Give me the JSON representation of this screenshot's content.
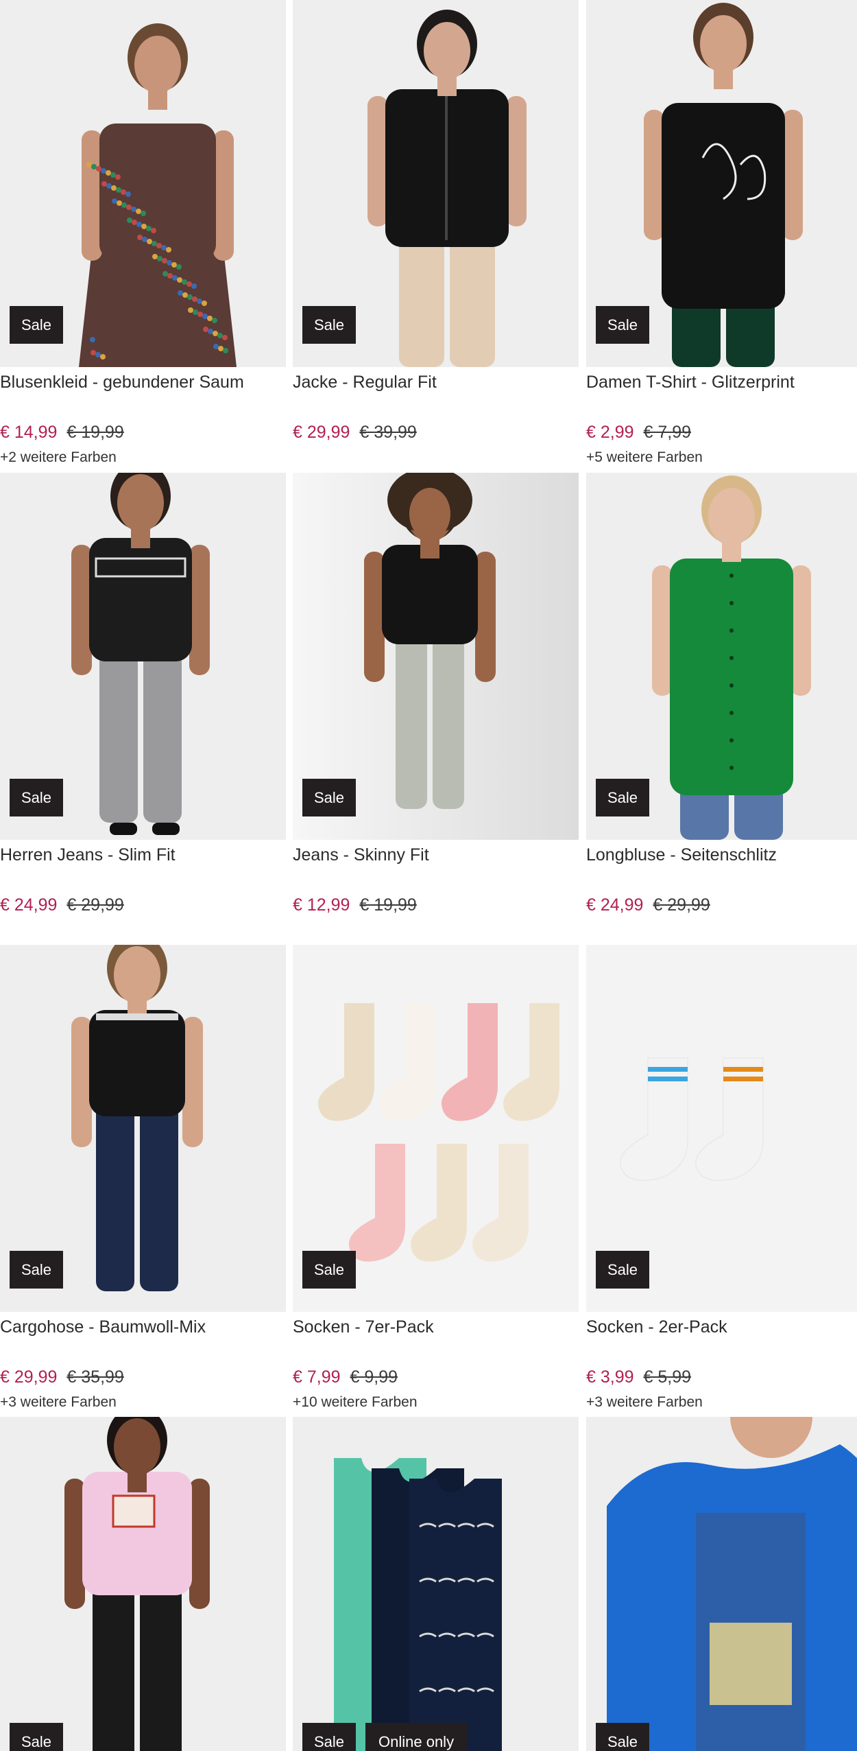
{
  "products": [
    {
      "title": "Blusenkleid - gebundener Saum",
      "price": "€ 14,99",
      "old_price": "€ 19,99",
      "colors": "+2 weitere Farben",
      "badges": [
        "Sale"
      ]
    },
    {
      "title": "Jacke - Regular Fit",
      "price": "€ 29,99",
      "old_price": "€ 39,99",
      "colors": "",
      "badges": [
        "Sale"
      ]
    },
    {
      "title": "Damen T-Shirt - Glitzerprint",
      "price": "€ 2,99",
      "old_price": "€ 7,99",
      "colors": "+5 weitere Farben",
      "badges": [
        "Sale"
      ]
    },
    {
      "title": "Herren Jeans - Slim Fit",
      "price": "€ 24,99",
      "old_price": "€ 29,99",
      "colors": "",
      "badges": [
        "Sale"
      ]
    },
    {
      "title": "Jeans - Skinny Fit",
      "price": "€ 12,99",
      "old_price": "€ 19,99",
      "colors": "",
      "badges": [
        "Sale"
      ]
    },
    {
      "title": "Longbluse - Seitenschlitz",
      "price": "€ 24,99",
      "old_price": "€ 29,99",
      "colors": "",
      "badges": [
        "Sale"
      ]
    },
    {
      "title": "Cargohose - Baumwoll-Mix",
      "price": "€ 29,99",
      "old_price": "€ 35,99",
      "colors": "+3 weitere Farben",
      "badges": [
        "Sale"
      ]
    },
    {
      "title": "Socken - 7er-Pack",
      "price": "€ 7,99",
      "old_price": "€ 9,99",
      "colors": "+10 weitere Farben",
      "badges": [
        "Sale"
      ]
    },
    {
      "title": "Socken - 2er-Pack",
      "price": "€ 3,99",
      "old_price": "€ 5,99",
      "colors": "+3 weitere Farben",
      "badges": [
        "Sale"
      ]
    },
    {
      "title": "",
      "price": "",
      "old_price": "",
      "colors": "",
      "badges": [
        "Sale"
      ]
    },
    {
      "title": "",
      "price": "",
      "old_price": "",
      "colors": "",
      "badges": [
        "Sale",
        "Online only"
      ]
    },
    {
      "title": "",
      "price": "",
      "old_price": "",
      "colors": "",
      "badges": [
        "Sale"
      ]
    }
  ],
  "images": [
    {
      "name": "floral-dress-photo",
      "colors": {
        "skin": "#c9957a",
        "hair": "#6b4a33",
        "main": "#5a3b35",
        "accent": "#c07a5c"
      }
    },
    {
      "name": "black-jacket-photo",
      "colors": {
        "skin": "#d3a78f",
        "hair": "#1d1a19",
        "main": "#141414",
        "accent": "#e2cdb4"
      }
    },
    {
      "name": "black-tshirt-photo",
      "colors": {
        "skin": "#d2a287",
        "hair": "#5b3e2c",
        "main": "#121212",
        "accent": "#0f3a2a"
      }
    },
    {
      "name": "nasa-jeans-photo",
      "colors": {
        "skin": "#a87458",
        "hair": "#2a1f1a",
        "main": "#1c1c1c",
        "accent": "#9a9a9c"
      }
    },
    {
      "name": "skinny-jeans-photo",
      "colors": {
        "skin": "#9a6546",
        "hair": "#3a2a1e",
        "main": "#141414",
        "accent": "#b9bcb2"
      }
    },
    {
      "name": "green-blouse-photo",
      "colors": {
        "skin": "#e4bba3",
        "hair": "#d8b888",
        "main": "#158a3a",
        "accent": "#5877a8"
      }
    },
    {
      "name": "cargo-pants-photo",
      "colors": {
        "skin": "#d4a488",
        "hair": "#7a5a3a",
        "main": "#151515",
        "accent": "#1d2a4a"
      }
    },
    {
      "name": "socks-7pack-photo",
      "colors": {
        "skin": "#f0e6d8",
        "hair": "#f2b3b6",
        "main": "#ebe1d3",
        "accent": "#8a5a3a"
      }
    },
    {
      "name": "socks-2pack-photo",
      "colors": {
        "skin": "#fafafa",
        "hair": "#3aa6e0",
        "main": "#f3f3f3",
        "accent": "#e58a1a"
      }
    },
    {
      "name": "pink-sweatshirt-photo",
      "colors": {
        "skin": "#7a4a34",
        "hair": "#1b1412",
        "main": "#f2c8e0",
        "accent": "#1a1a1a"
      }
    },
    {
      "name": "tank-tops-photo",
      "colors": {
        "skin": "#55c4a6",
        "hair": "#0f1a33",
        "main": "#13203d",
        "accent": "#d9d9d9"
      }
    },
    {
      "name": "blue-print-tshirt-photo",
      "colors": {
        "skin": "#d8a88c",
        "hair": "#4a3426",
        "main": "#1d6ad0",
        "accent": "#f0d98a"
      }
    }
  ]
}
